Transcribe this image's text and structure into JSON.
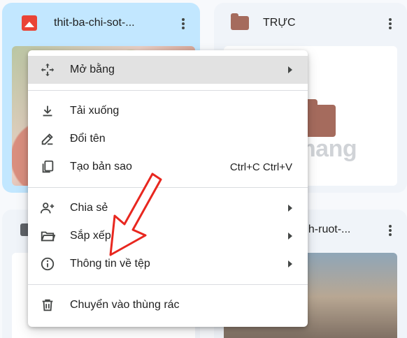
{
  "cards": {
    "top_left": {
      "title": "thit-ba-chi-sot-...",
      "icon": "image-file-icon"
    },
    "top_right": {
      "title": "TRỰC",
      "icon": "folder-icon"
    },
    "bottom_right": {
      "title": "nh-ruot-..."
    }
  },
  "watermark": {
    "text": "uantrimang"
  },
  "context_menu": {
    "items": [
      {
        "label": "Mở bằng",
        "icon": "move-arrows-icon",
        "submenu": true,
        "highlighted": true
      },
      {
        "label": "Tải xuống",
        "icon": "download-icon"
      },
      {
        "label": "Đổi tên",
        "icon": "pencil-icon"
      },
      {
        "label": "Tạo bản sao",
        "icon": "copy-icon",
        "shortcut": "Ctrl+C Ctrl+V"
      },
      {
        "label": "Chia sẻ",
        "icon": "person-add-icon",
        "submenu": true
      },
      {
        "label": "Sắp xếp",
        "icon": "folder-open-icon",
        "submenu": true
      },
      {
        "label": "Thông tin về tệp",
        "icon": "info-icon",
        "submenu": true
      },
      {
        "label": "Chuyển vào thùng rác",
        "icon": "trash-icon"
      }
    ]
  },
  "colors": {
    "selected_card": "#c2e7ff",
    "folder_brown": "#a56b5d",
    "annotation_red": "#e8271f",
    "image_icon_red": "#ea4335"
  }
}
